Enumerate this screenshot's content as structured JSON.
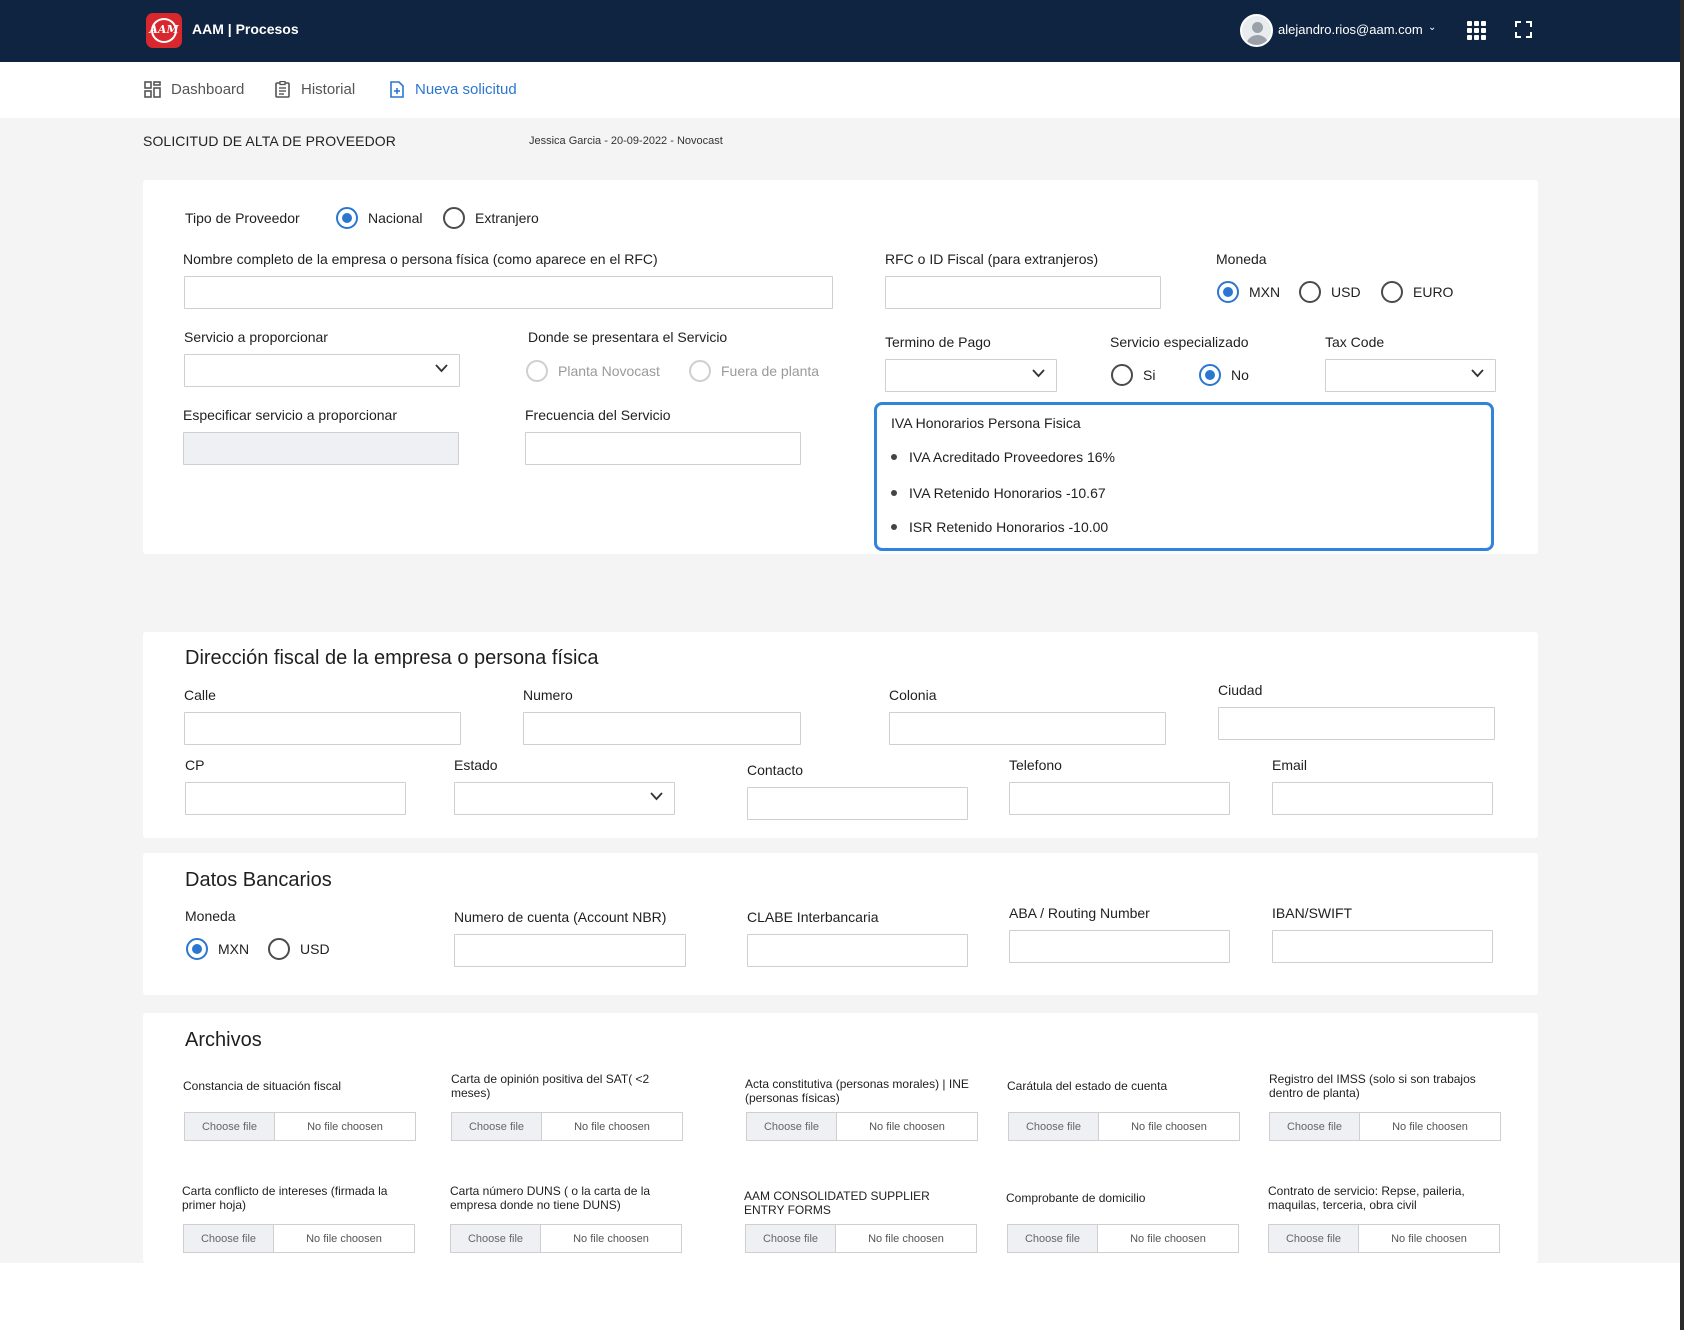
{
  "app": {
    "logo_text": "AAM",
    "title": "AAM | Procesos"
  },
  "user": {
    "email": "alejandro.rios@aam.com",
    "caret": "⌄"
  },
  "nav": {
    "dashboard": "Dashboard",
    "historial": "Historial",
    "nueva": "Nueva solicitud"
  },
  "page": {
    "title": "SOLICITUD DE ALTA DE PROVEEDOR",
    "meta": "Jessica Garcia - 20-09-2022 - Novocast"
  },
  "proveedor": {
    "tipo_label": "Tipo de Proveedor",
    "tipo_nacional": "Nacional",
    "tipo_extranjero": "Extranjero",
    "nombre_label": "Nombre completo de la empresa o persona física (como aparece en el RFC)",
    "rfc_label": "RFC o ID Fiscal (para extranjeros)",
    "moneda_label": "Moneda",
    "moneda_mxn": "MXN",
    "moneda_usd": "USD",
    "moneda_euro": "EURO",
    "servicio_label": "Servicio a  proporcionar",
    "donde_label": "Donde se presentara el Servicio",
    "donde_planta": "Planta Novocast",
    "donde_fuera": "Fuera de planta",
    "termino_label": "Termino de Pago",
    "especializado_label": "Servicio especializado",
    "esp_si": "Si",
    "esp_no": "No",
    "taxcode_label": "Tax Code",
    "especificar_label": "Especificar servicio a proporcionar",
    "frecuencia_label": "Frecuencia del Servicio"
  },
  "iva": {
    "title": "IVA Honorarios Persona Fisica",
    "items": [
      "IVA Acreditado Proveedores 16%",
      "IVA Retenido Honorarios -10.67",
      "ISR Retenido Honorarios -10.00"
    ]
  },
  "direccion": {
    "title": "Dirección fiscal de la empresa o persona física",
    "calle": "Calle",
    "numero": "Numero",
    "colonia": "Colonia",
    "ciudad": "Ciudad",
    "cp": "CP",
    "estado": "Estado",
    "contacto": "Contacto",
    "telefono": "Telefono",
    "email": "Email"
  },
  "bancarios": {
    "title": "Datos Bancarios",
    "moneda": "Moneda",
    "mxn": "MXN",
    "usd": "USD",
    "cuenta": "Numero de cuenta (Account NBR)",
    "clabe": "CLABE Interbancaria",
    "aba": "ABA / Routing Number",
    "iban": "IBAN/SWIFT"
  },
  "archivos": {
    "title": "Archivos",
    "choose": "Choose file",
    "none": "No file choosen",
    "labels": [
      "Constancia de situación fiscal",
      "Carta de opinión positiva del SAT( <2 meses)",
      "Acta constitutiva (personas morales) | INE (personas físicas)",
      "Carátula del estado de cuenta",
      "Registro del IMSS (solo si son trabajos dentro de planta)",
      "Carta conflicto de intereses (firmada la primer hoja)",
      "Carta número DUNS ( o la carta de la empresa donde no tiene DUNS)",
      "AAM CONSOLIDATED SUPPLIER ENTRY FORMS",
      "Comprobante de domicilio",
      "Contrato de servicio: Repse, paileria, maquilas, terceria, obra civil"
    ]
  },
  "colors": {
    "topbar": "#0f2440",
    "accent": "#2b77d0",
    "logo": "#d9272e",
    "background": "#f4f4f4"
  }
}
